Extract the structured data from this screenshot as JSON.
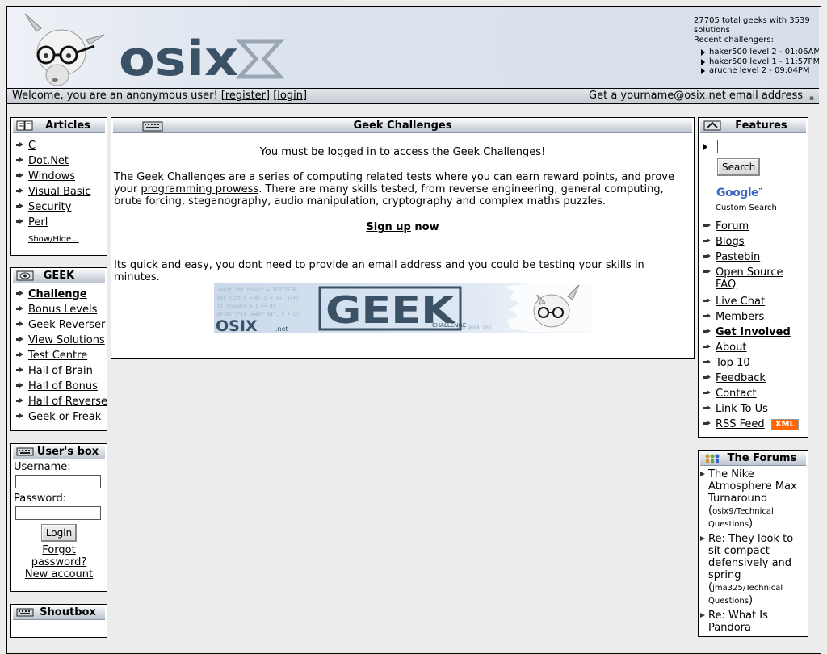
{
  "header": {
    "logo_text": "osix",
    "stats": "27705 total geeks with 3539 solutions",
    "recent_label": "Recent challengers:",
    "recent": [
      "haker500 level 2 - 01:06AM",
      "haker500 level 1 - 11:57PM",
      "aruche level 2 - 09:04PM"
    ]
  },
  "welcome": {
    "prefix": "Welcome, you are an anonymous user! [",
    "register": "register",
    "mid": "] [",
    "login": "login",
    "suffix": "]",
    "email_promo": "Get a yourname@osix.net email address"
  },
  "articles": {
    "title": "Articles",
    "items": [
      "C",
      "Dot.Net",
      "Windows",
      "Visual Basic",
      "Security",
      "Perl"
    ],
    "show_hide": "Show/Hide..."
  },
  "geek": {
    "title": "GEEK",
    "items": [
      "Challenge",
      "Bonus Levels",
      "Geek Reverser",
      "View Solutions",
      "Test Centre",
      "Hall of Brain",
      "Hall of Bonus",
      "Hall of Reverse",
      "Geek or Freak"
    ]
  },
  "userbox": {
    "title": "User's box",
    "username_label": "Username:",
    "password_label": "Password:",
    "login_button": "Login",
    "forgot": "Forgot password?",
    "new_account": "New account"
  },
  "shoutbox": {
    "title": "Shoutbox"
  },
  "main": {
    "title": "Geek Challenges",
    "login_notice": "You must be logged in to access the Geek Challenges!",
    "desc_1": "The Geek Challenges are a series of computing related tests where you can earn reward points, and prove your ",
    "desc_link": "programming prowess",
    "desc_2": ". There are many skills tested, from reverse engineering, general computing, brute forcing, steganography, audio manipulation, cryptography and complex maths puzzles.",
    "signup_link": "Sign up",
    "signup_rest": " now",
    "quick": "Its quick and easy, you dont need to provide an email address and you could be testing your skills in minutes.",
    "banner": {
      "word": "GEEK",
      "sub": "CHALLENGE",
      "brand": "OSIX",
      "domain": ".net",
      "code_1": "const int result = 15677676;",
      "code_2": "for (int i = 0; i < 15; i++)",
      "code_3": "if (result % i == 0)",
      "code_4": "printf(\"Is Geek? %d\", s + i);",
      "footer_code": "you geek on?"
    }
  },
  "features": {
    "title": "Features",
    "search_value": "",
    "search_button": "Search",
    "google_logo": "Google",
    "google_tm": "™",
    "custom_search": "Custom Search",
    "items": [
      "Forum",
      "Blogs",
      "Pastebin",
      "Open Source FAQ",
      "Live Chat",
      "Members",
      "Get Involved",
      "About",
      "Top 10",
      "Feedback",
      "Contact",
      "Link To Us",
      "RSS Feed"
    ],
    "xml_badge": "XML"
  },
  "forums": {
    "title": "The Forums",
    "posts": [
      {
        "title": "The Nike Atmosphere Max Turnaround",
        "meta": "osix9/Technical Questions"
      },
      {
        "title": "Re: They look to sit compact defensively and spring",
        "meta": "jma325/Technical Questions"
      },
      {
        "title": "Re: What Is Pandora",
        "meta": ""
      }
    ]
  },
  "colors": {
    "accent_orange": "#ff6600",
    "header_blue": "#dbe3ee",
    "logo_blue": "#3b5166"
  }
}
